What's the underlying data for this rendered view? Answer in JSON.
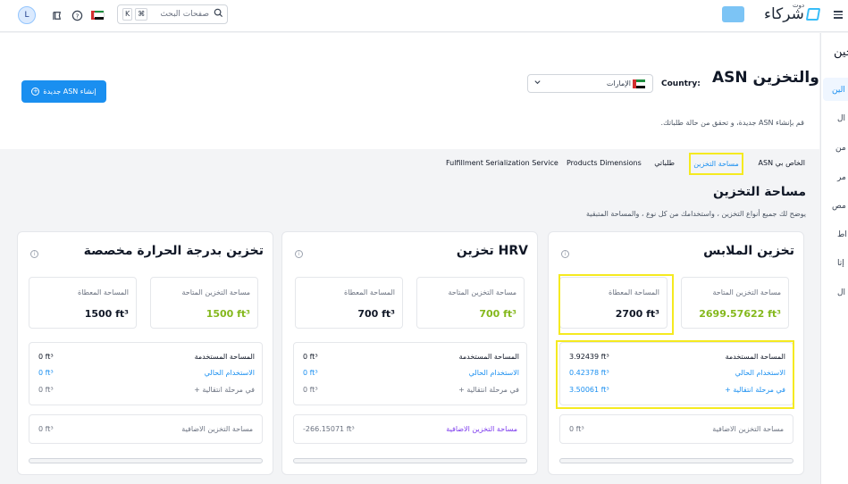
{
  "topbar": {
    "avatar_initial": "L",
    "search_placeholder": "صفحات البحث",
    "search_shortcut_key": "K",
    "search_shortcut_mod": "⌘",
    "logo_text": "شركاء",
    "logo_small": "دوت"
  },
  "sidebar": {
    "heading": "جين",
    "items": [
      "الين",
      "ال",
      "من",
      "مر",
      "مص",
      "اط",
      "إتا",
      "ال"
    ]
  },
  "header": {
    "title": "ASN والتخزين",
    "country_label": "Country:",
    "country_value": "الإمارات",
    "subtitle": "قم بإنشاء ASN جديدة، و تحقق من حالة طلباتك.",
    "create_button": "إنشاء ASN جديدة"
  },
  "tabs": [
    {
      "label": "ASN الخاص بي"
    },
    {
      "label": "مساحة التخزين",
      "active": true
    },
    {
      "label": "طلباتي"
    },
    {
      "label": "Products Dimensions"
    },
    {
      "label": "Fulfillment Serialization Service"
    }
  ],
  "section": {
    "title": "مساحة التخزين",
    "subtitle": "يوضح لك جميع أنواع التخزين ، واستخدامك من كل نوع ، والمساحة المتبقية"
  },
  "labels": {
    "available": "مساحة التخزين المتاحة",
    "reserved": "المساحة المعطاة",
    "used": "المساحة المستخدمة",
    "current_usage": "الاستخدام الحالي",
    "transit": "+ في مرحلة انتقالية",
    "extra": "مساحة التخزين الاضافية"
  },
  "cards": [
    {
      "title": "تخزين الملابس",
      "available": "2699.57622 ft³",
      "reserved": "2700 ft³",
      "used": "3.92439 ft³",
      "current": "0.42378 ft³",
      "transit": "3.50061 ft³",
      "extra": "0 ft³"
    },
    {
      "title": "تخزين HRV",
      "available": "700 ft³",
      "reserved": "700 ft³",
      "used": "0 ft³",
      "current": "0 ft³",
      "transit": "0 ft³",
      "extra": "-266.15071 ft³"
    },
    {
      "title": "تخزين بدرجة الحرارة مخصصة",
      "available": "1500 ft³",
      "reserved": "1500 ft³",
      "used": "0 ft³",
      "current": "0 ft³",
      "transit": "0 ft³",
      "extra": "0 ft³"
    }
  ],
  "colors": {
    "primary": "#1a8ff0",
    "green_value": "#84b81c",
    "highlight": "#f5ea20",
    "extra_label_purple": "#7c3aed"
  }
}
